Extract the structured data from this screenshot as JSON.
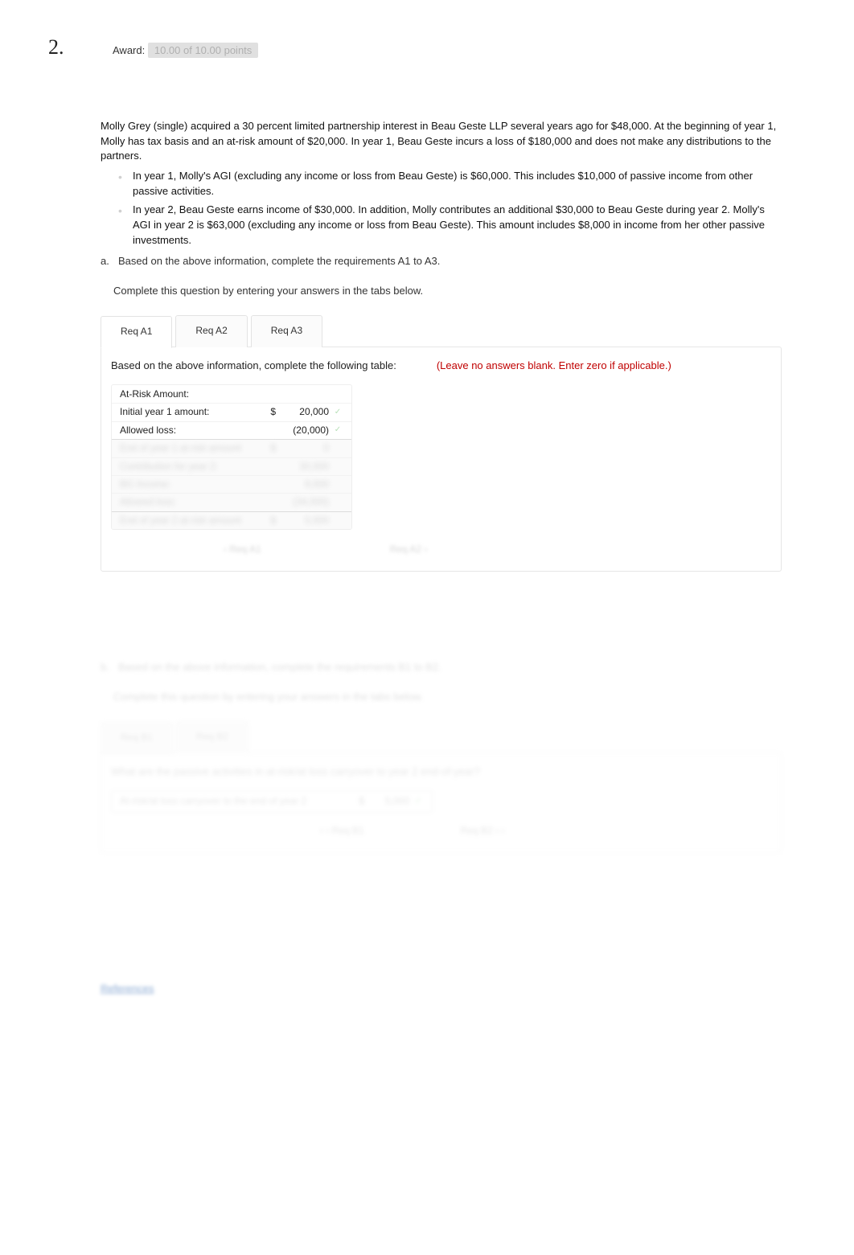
{
  "question": {
    "number": "2.",
    "award_label": "Award:",
    "award_value": "10.00 of 10.00 points"
  },
  "stem": {
    "para1": "Molly Grey (single) acquired a 30 percent limited partnership interest in Beau Geste LLP several years ago for $48,000. At the beginning of year 1, Molly has tax basis and an at-risk amount of $20,000. In year 1, Beau Geste incurs a loss of $180,000 and does not make any distributions to the partners.",
    "bullets": [
      "In year 1, Molly's AGI (excluding any income or loss from Beau Geste) is $60,000. This includes $10,000 of passive income from other passive activities.",
      "In year 2, Beau Geste earns income of $30,000. In addition, Molly contributes an additional $30,000 to Beau Geste during year 2. Molly's AGI in year 2 is $63,000 (excluding any income or loss from Beau Geste). This amount includes $8,000 in income from her other passive investments."
    ],
    "sub_a_letter": "a.",
    "sub_a_text": "Based on the above information, complete the requirements A1 to A3.",
    "instr": "Complete this question by entering your answers in the tabs below."
  },
  "tabs_a": {
    "items": [
      "Req A1",
      "Req A2",
      "Req A3"
    ],
    "active": 0
  },
  "panel_a": {
    "question": "Based on the above information, complete the following table:",
    "hint": "(Leave no answers blank. Enter zero if applicable.)",
    "table": {
      "header": "At-Risk Amount:",
      "rows": [
        {
          "label": "Initial year 1 amount:",
          "currency": "$",
          "value": "20,000",
          "mark": "✓"
        },
        {
          "label": "Allowed loss:",
          "currency": "",
          "value": "(20,000)",
          "mark": "✓"
        },
        {
          "label": "End of year 1 at-risk amount",
          "currency": "$",
          "value": "0",
          "mark": "",
          "blur": true
        },
        {
          "label": "Contribution for year 2:",
          "currency": "",
          "value": "30,000",
          "mark": "",
          "blur": true
        },
        {
          "label": "BG Income:",
          "currency": "",
          "value": "9,000",
          "mark": "",
          "blur": true
        },
        {
          "label": "Allowed loss:",
          "currency": "",
          "value": "(34,000)",
          "mark": "",
          "blur": true
        },
        {
          "label": "End of year 2 at-risk amount",
          "currency": "$",
          "value": "5,000",
          "mark": "",
          "blur": true
        }
      ]
    },
    "nav_prev": "‹ Req A1",
    "nav_next": "Req A2 ›"
  },
  "section_b": {
    "sub_letter": "b.",
    "sub_text": "Based on the above information, complete the requirements B1 to B2.",
    "instr": "Complete this question by entering your answers in the tabs below.",
    "tabs": [
      "Req B1",
      "Req B2"
    ],
    "panel_q": "What are the passive activities in at-risk/at loss carryover to year 2 end-of-year?",
    "row": {
      "label": "At-risk/at loss carryover to the end of year 2",
      "currency": "$",
      "value": "5,000",
      "mark": "✓"
    },
    "nav_prev": "‹ Req B1",
    "nav_next": "Req B2 ›"
  },
  "refs": {
    "label": "References"
  }
}
